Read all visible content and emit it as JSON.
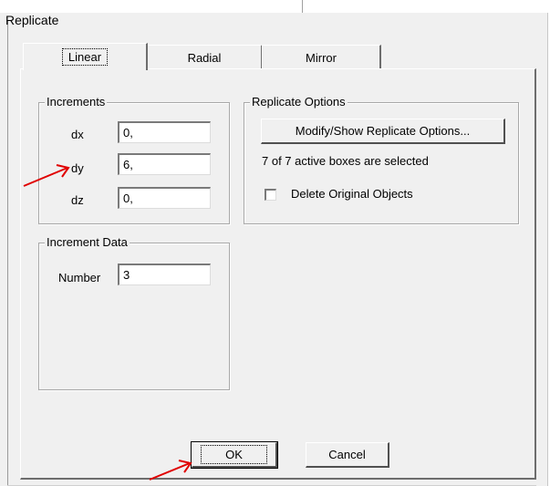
{
  "dialog": {
    "title": "Replicate",
    "tabs": [
      {
        "label": "Linear",
        "active": true
      },
      {
        "label": "Radial",
        "active": false
      },
      {
        "label": "Mirror",
        "active": false
      }
    ]
  },
  "increments": {
    "label": "Increments",
    "dx": {
      "label": "dx",
      "value": "0,"
    },
    "dy": {
      "label": "dy",
      "value": "6,"
    },
    "dz": {
      "label": "dz",
      "value": "0,"
    }
  },
  "increment_data": {
    "label": "Increment Data",
    "number_label": "Number",
    "number_value": "3"
  },
  "replicate_options": {
    "label": "Replicate Options",
    "modify_button": "Modify/Show Replicate Options...",
    "status_text": "7 of 7 active boxes are selected",
    "delete_original_label": "Delete Original Objects",
    "delete_original_checked": false
  },
  "buttons": {
    "ok": "OK",
    "cancel": "Cancel"
  },
  "annotations": {
    "arrow_color": "#e00000"
  }
}
